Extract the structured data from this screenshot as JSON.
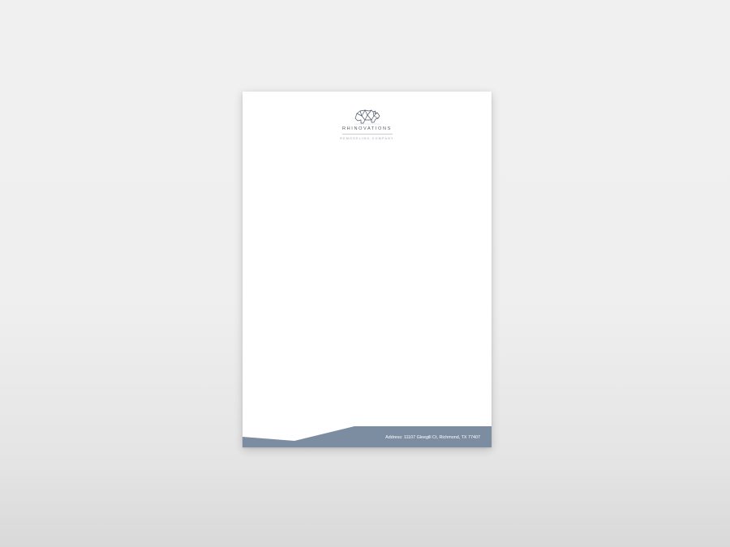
{
  "letterhead": {
    "brand": {
      "name": "RHINOVATIONS",
      "tagline": "REMODELING COMPANY",
      "logo_icon": "rhino-icon"
    },
    "footer": {
      "address": "Address: 11107 Gleegill Ct, Richmond, TX 77407",
      "band_color": "#7d8da1"
    }
  }
}
